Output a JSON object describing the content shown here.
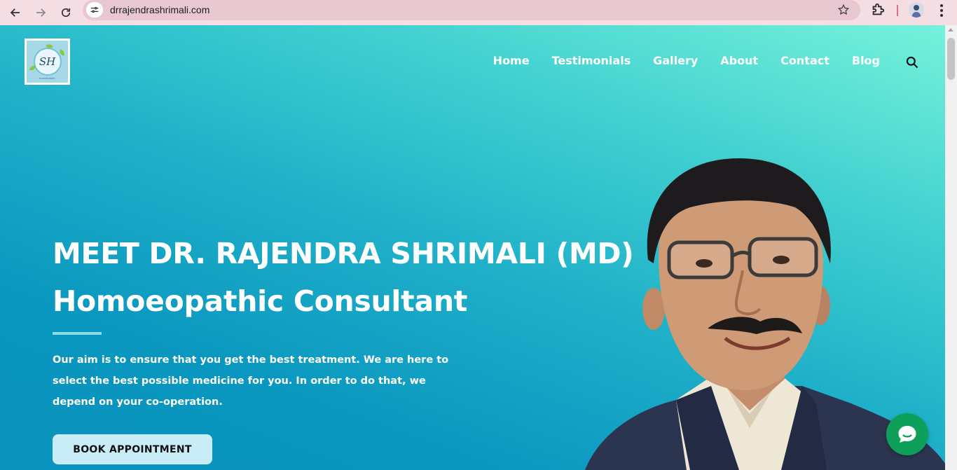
{
  "browser": {
    "url": "drrajendrashrimali.com",
    "icons": [
      "back-icon",
      "forward-icon",
      "reload-icon",
      "site-info-icon",
      "bookmark-star-icon",
      "extensions-icon",
      "profile-avatar",
      "more-menu-icon"
    ]
  },
  "site": {
    "logo_text": "SH",
    "logo_tagline": "HOMOEOPATHY"
  },
  "nav": {
    "items": [
      "Home",
      "Testimonials",
      "Gallery",
      "About",
      "Contact",
      "Blog"
    ]
  },
  "hero": {
    "title_line1": "MEET DR. RAJENDRA SHRIMALI (MD)",
    "title_line2": "Homoeopathic Consultant",
    "description": "Our aim is to ensure that you get the best treatment. We are here to select the best possible medicine for you. In order to do that, we depend on your co-operation.",
    "cta_label": "BOOK APPOINTMENT"
  },
  "colors": {
    "gradient_top": "#76f2da",
    "gradient_bottom": "#0a93bd",
    "chat_button": "#0e9f5a",
    "cta_background": "#c9edf6"
  }
}
